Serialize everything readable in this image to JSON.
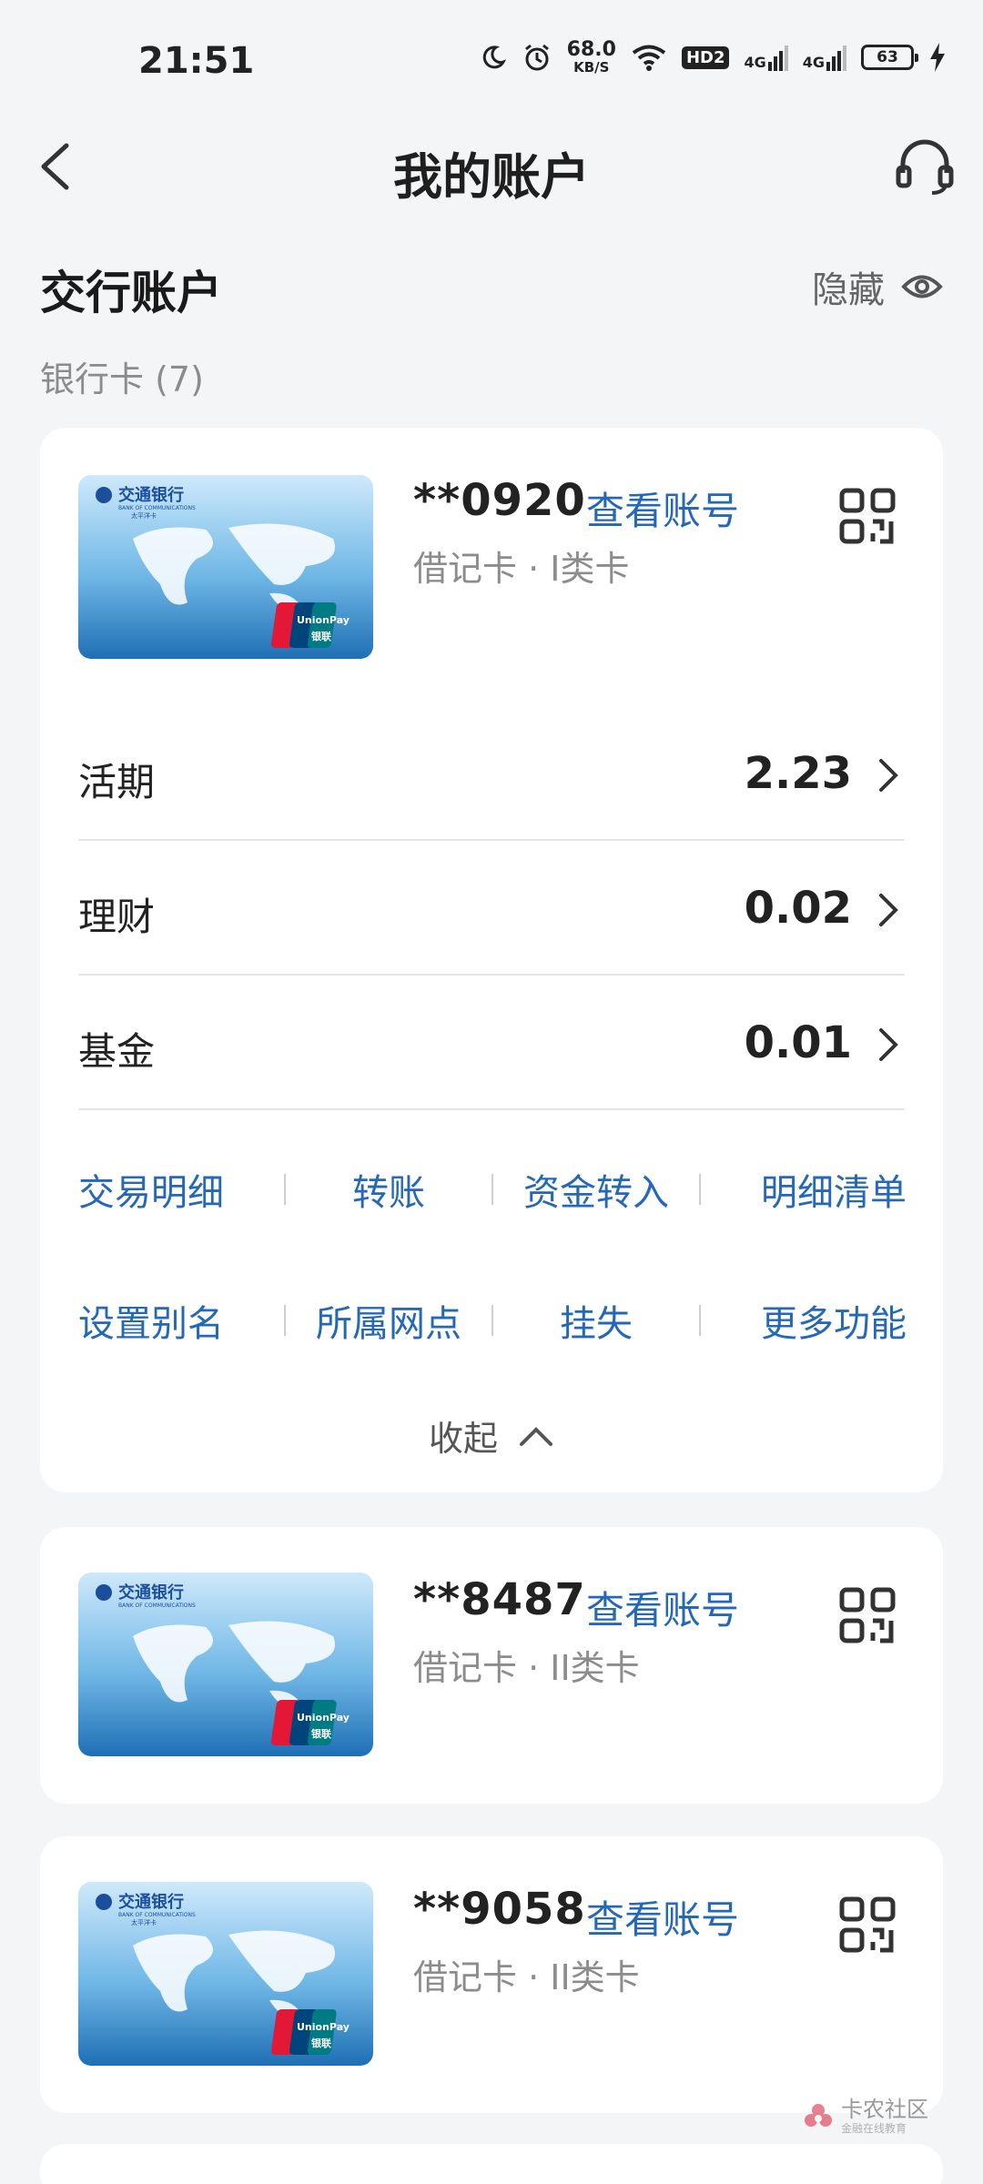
{
  "status_bar": {
    "time": "21:51",
    "net_speed": "68.0",
    "net_unit": "KB/S",
    "hd_badge": "HD2",
    "signal1": "4G",
    "signal2": "4G",
    "battery": "63",
    "icons": [
      "moon-icon",
      "alarm-icon",
      "wifi-icon",
      "signal-icon",
      "battery-icon",
      "charging-icon"
    ]
  },
  "nav": {
    "title": "我的账户",
    "back_icon": "chevron-left-icon",
    "support_icon": "headset-icon"
  },
  "section": {
    "title": "交行账户",
    "hide_label": "隐藏",
    "hide_icon": "eye-icon",
    "card_count_label": "银行卡 (7)"
  },
  "cards": [
    {
      "number": "**0920",
      "view_label": "查看账号",
      "type": "借记卡 · I类卡",
      "balances": [
        {
          "label": "活期",
          "value": "2.23"
        },
        {
          "label": "理财",
          "value": "0.02"
        },
        {
          "label": "基金",
          "value": "0.01"
        }
      ],
      "actions_row1": [
        "交易明细",
        "转账",
        "资金转入",
        "明细清单"
      ],
      "actions_row2": [
        "设置别名",
        "所属网点",
        "挂失",
        "更多功能"
      ],
      "collapse_label": "收起"
    },
    {
      "number": "**8487",
      "view_label": "查看账号",
      "type": "借记卡 · II类卡"
    },
    {
      "number": "**9058",
      "view_label": "查看账号",
      "type": "借记卡 · II类卡"
    }
  ],
  "card_art": {
    "bank_name": "交通银行",
    "bank_name_en": "BANK OF COMMUNICATIONS",
    "card_name": "太平洋卡",
    "network": "UnionPay",
    "network_cn": "银联"
  },
  "watermark": {
    "title": "卡农社区",
    "subtitle": "金融在线教育"
  },
  "colors": {
    "accent": "#2468b7",
    "background": "#f4f5f7",
    "panel": "#ffffff"
  }
}
